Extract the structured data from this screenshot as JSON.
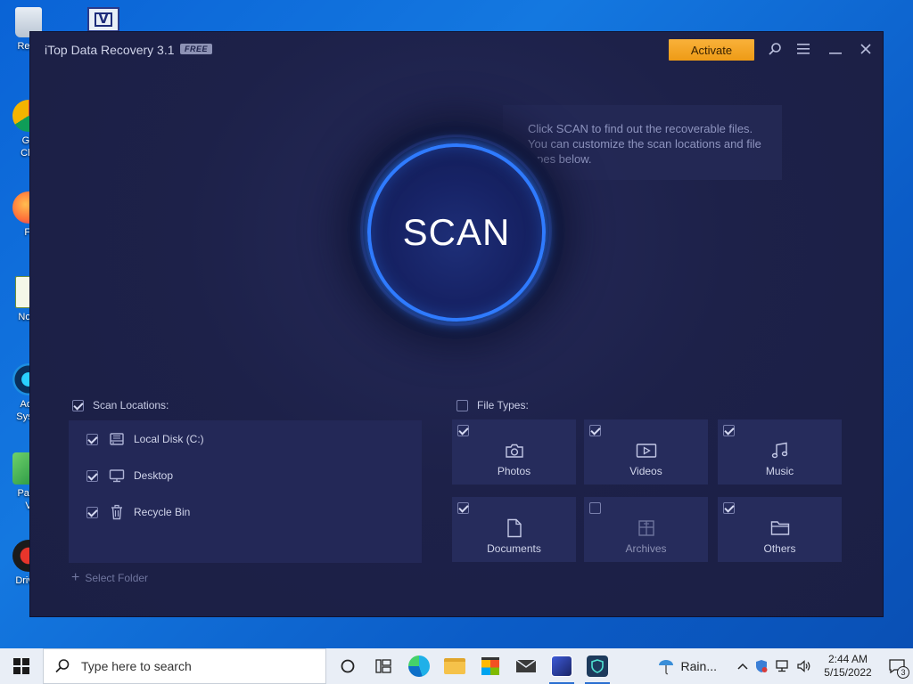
{
  "desktop": {
    "icons": [
      {
        "label": "Recy",
        "icon": "recycle-bin-icon"
      },
      {
        "label": "Go\nChr",
        "icon": "chrome-icon"
      },
      {
        "label": "Fi",
        "icon": "firefox-icon"
      },
      {
        "label": "Note",
        "icon": "notepad-icon"
      },
      {
        "label": "Adv\nSyste",
        "icon": "advanced-systemcare-icon"
      },
      {
        "label": "Paint\nV",
        "icon": "paint-icon"
      },
      {
        "label": "Driver",
        "icon": "driver-icon"
      }
    ]
  },
  "app": {
    "title": "iTop Data Recovery 3.1",
    "badge": "FREE",
    "activate_label": "Activate",
    "scan_label": "SCAN",
    "hint": "Click SCAN to find out the recoverable files. You can customize the scan locations and file types below.",
    "scan_locations": {
      "heading": "Scan Locations:",
      "checked": true,
      "items": [
        {
          "label": "Local Disk (C:)",
          "icon": "hard-drive-icon",
          "checked": true
        },
        {
          "label": "Desktop",
          "icon": "monitor-icon",
          "checked": true
        },
        {
          "label": "Recycle Bin",
          "icon": "trash-icon",
          "checked": true
        }
      ],
      "select_folder": "Select Folder"
    },
    "file_types": {
      "heading": "File Types:",
      "checked": false,
      "items": [
        {
          "label": "Photos",
          "icon": "camera-icon",
          "checked": true
        },
        {
          "label": "Videos",
          "icon": "video-icon",
          "checked": true
        },
        {
          "label": "Music",
          "icon": "music-icon",
          "checked": true
        },
        {
          "label": "Documents",
          "icon": "document-icon",
          "checked": true
        },
        {
          "label": "Archives",
          "icon": "archive-icon",
          "checked": false
        },
        {
          "label": "Others",
          "icon": "folder-icon",
          "checked": true
        }
      ]
    },
    "colors": {
      "accent": "#2f7bff",
      "activate": "#f5a623",
      "background": "#1d2149"
    }
  },
  "taskbar": {
    "search_placeholder": "Type here to search",
    "weather": "Rain...",
    "time": "2:44 AM",
    "date": "5/15/2022",
    "notification_count": "3"
  }
}
